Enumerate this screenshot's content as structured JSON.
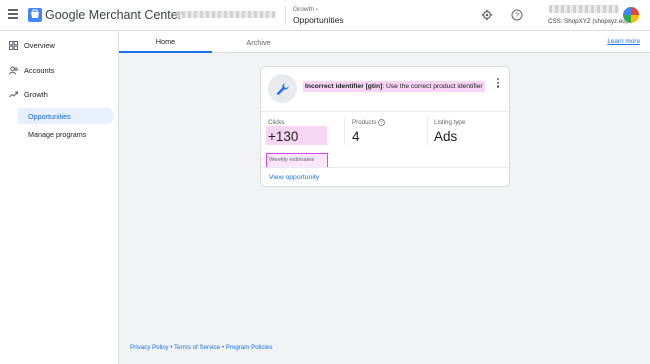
{
  "header": {
    "app_title_brand": "Google",
    "app_title_product": "Merchant Center",
    "breadcrumb_parent": "Growth",
    "breadcrumb_current": "Opportunities",
    "account_label": "CSS: ShopXYZ (shopxyz.eu)",
    "icons": [
      "menu-icon",
      "merchant-center-logo",
      "gear-icon",
      "help-icon",
      "avatar"
    ]
  },
  "sidebar": {
    "items": [
      {
        "label": "Overview",
        "icon": "overview-icon"
      },
      {
        "label": "Accounts",
        "icon": "accounts-icon"
      },
      {
        "label": "Growth",
        "icon": "growth-icon"
      }
    ],
    "sub_items": [
      {
        "label": "Opportunities",
        "active": true
      },
      {
        "label": "Manage programs",
        "active": false
      }
    ]
  },
  "tabs": [
    {
      "label": "Home",
      "active": true
    },
    {
      "label": "Archive",
      "active": false
    }
  ],
  "learn_more": "Learn more",
  "card": {
    "title_bold": "Incorrect identifier [gtin]",
    "title_rest": ": Use the correct product identifier",
    "metrics": [
      {
        "label": "Clicks",
        "value": "+130"
      },
      {
        "label": "Products",
        "value": "4"
      },
      {
        "label": "Listing type",
        "value": "Ads"
      }
    ],
    "weekly_note": "Weekly estimates",
    "view_link": "View opportunity"
  },
  "footer": {
    "links": [
      "Privacy Policy",
      "Terms of Service",
      "Program Policies"
    ],
    "separator": " • "
  },
  "colors": {
    "accent": "#1a73e8",
    "highlight_pink": "#f7d6f4",
    "outline_magenta": "#d946ef",
    "active_nav_bg": "#e8f0fe"
  }
}
